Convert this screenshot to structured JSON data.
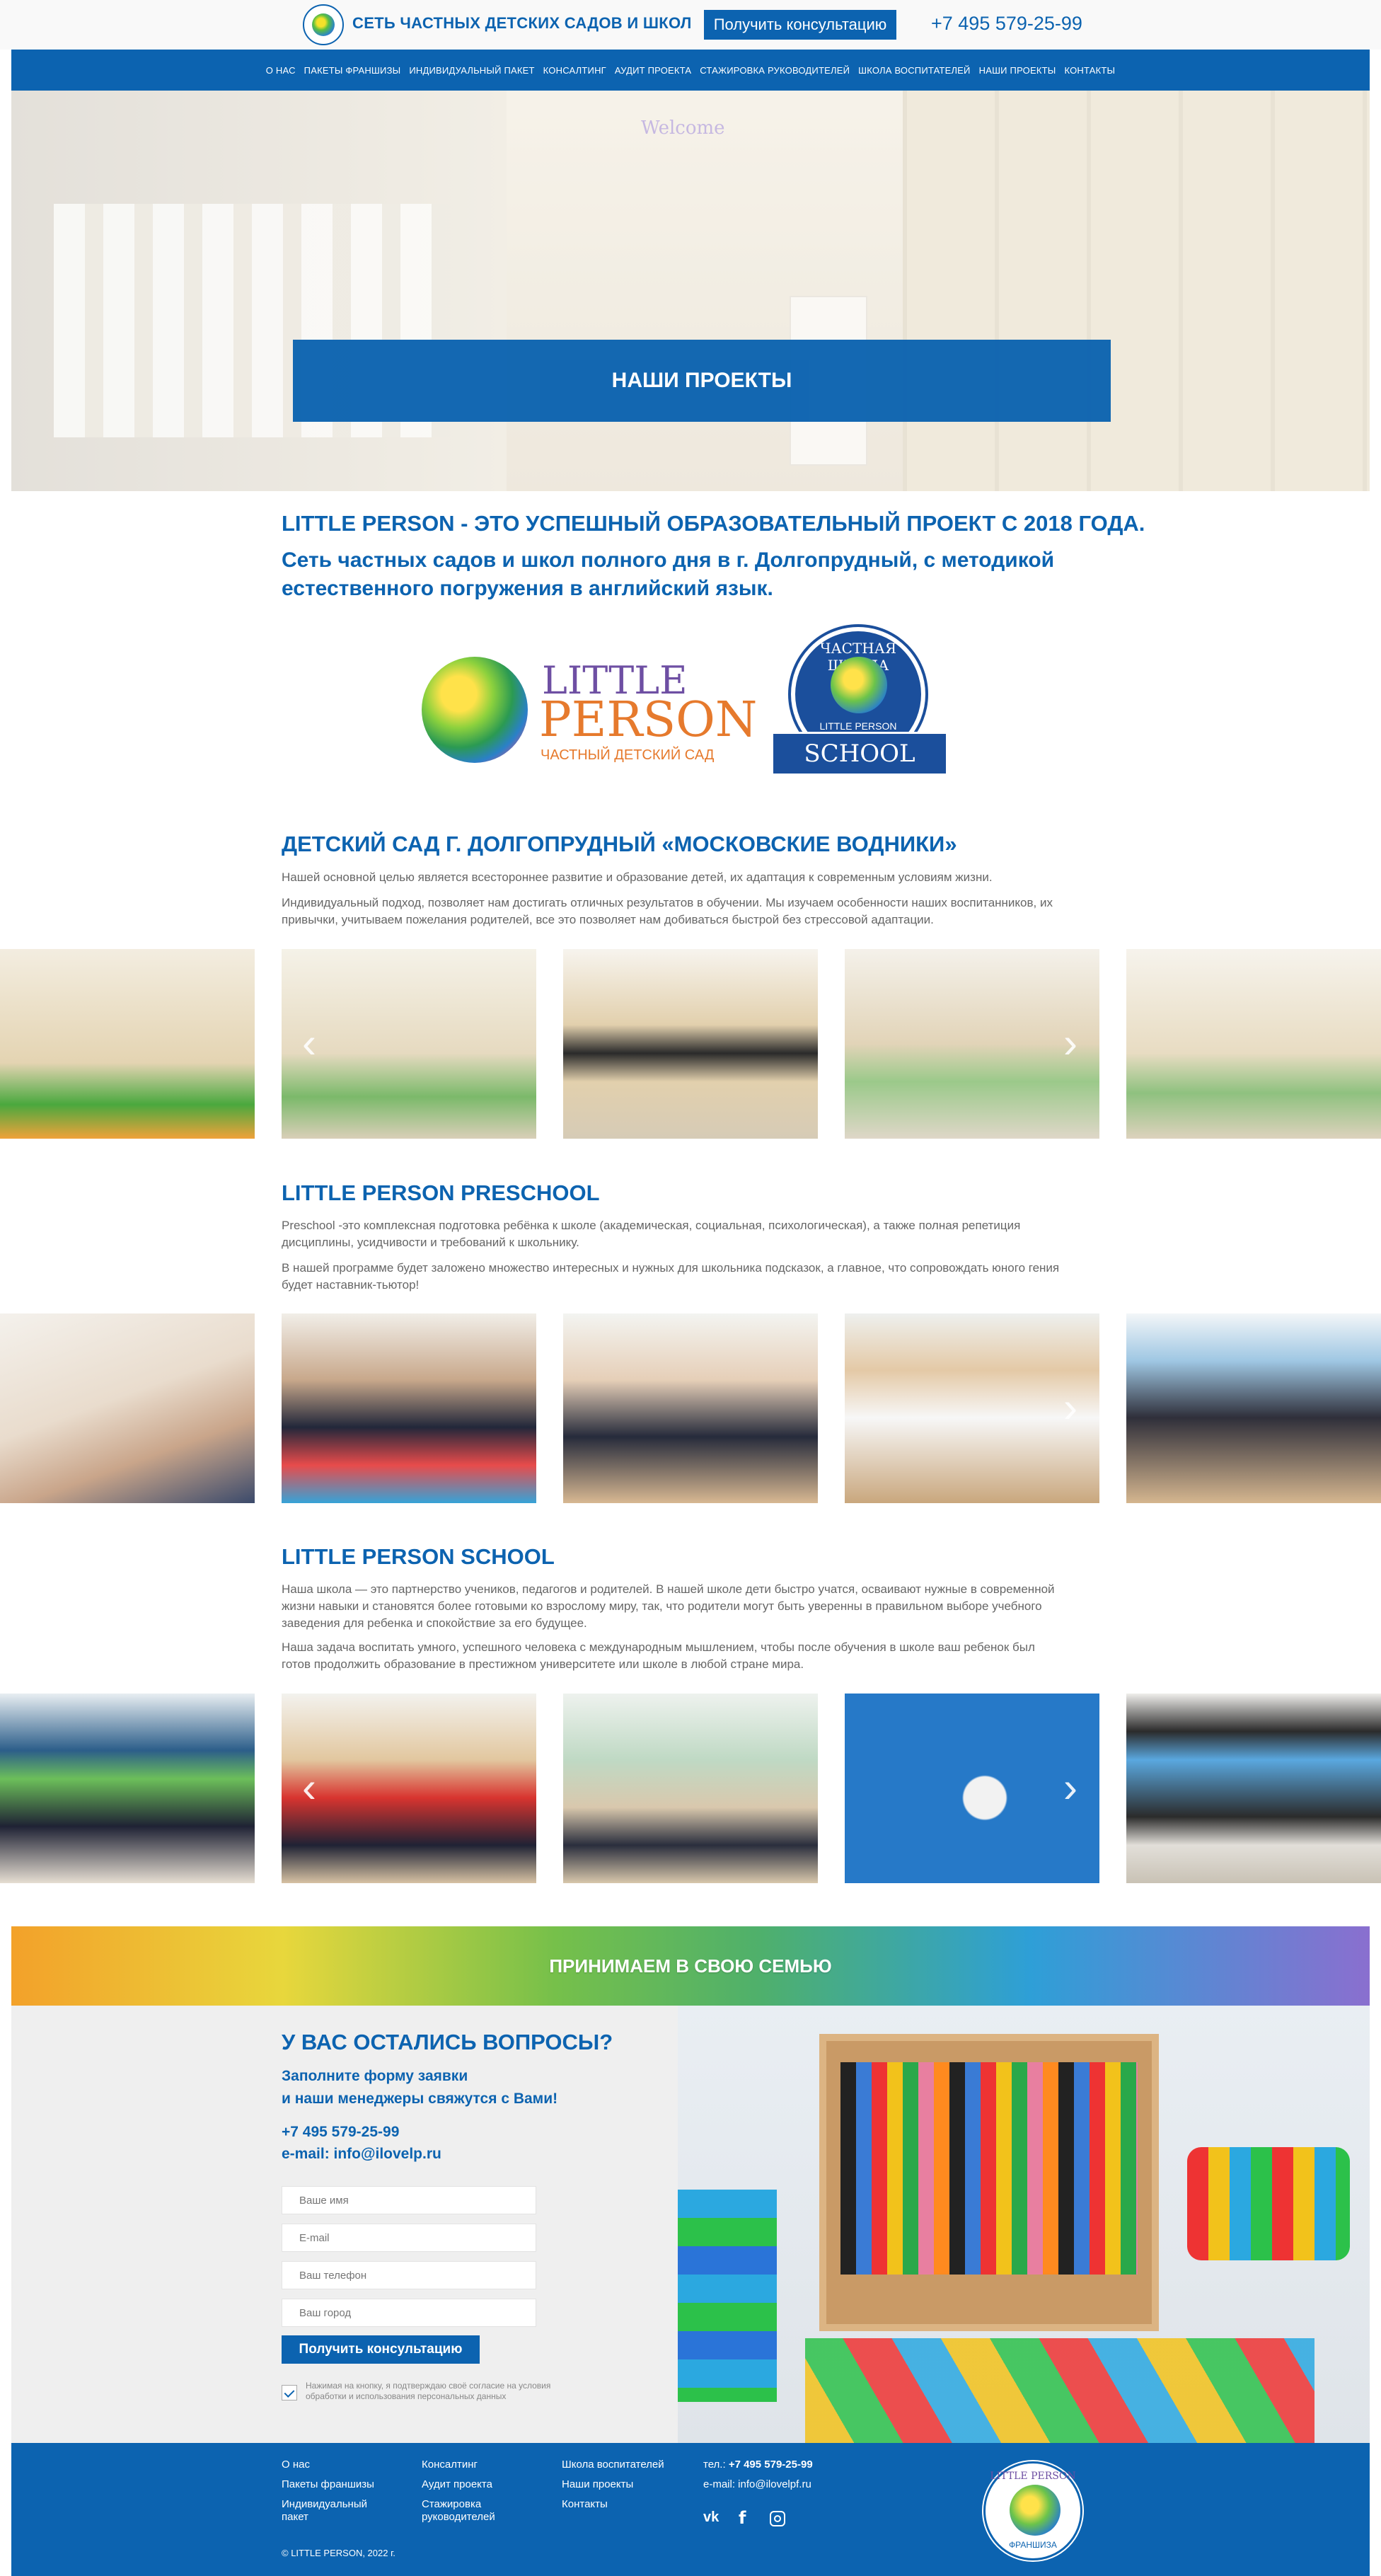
{
  "header": {
    "brand": "СЕТЬ ЧАСТНЫХ ДЕТСКИХ САДОВ И ШКОЛ",
    "cta": "Получить консультацию",
    "phone": "+7 495 579-25-99"
  },
  "nav": [
    "О НАС",
    "ПАКЕТЫ ФРАНШИЗЫ",
    "ИНДИВИДУАЛЬНЫЙ ПАКЕТ",
    "КОНСАЛТИНГ",
    "АУДИТ ПРОЕКТА",
    "СТАЖИРОВКА РУКОВОДИТЕЛЕЙ",
    "ШКОЛА ВОСПИТАТЕЛЕЙ",
    "НАШИ ПРОЕКТЫ",
    "КОНТАКТЫ"
  ],
  "hero": {
    "title": "НАШИ ПРОЕКТЫ",
    "sign": "Welcome"
  },
  "intro": {
    "headline": "LITTLE PERSON - ЭТО УСПЕШНЫЙ ОБРАЗОВАТЕЛЬНЫЙ ПРОЕКТ С 2018 ГОДА.",
    "subhead": "Сеть частных садов и школ полного дня в г. Долгопрудный, с методикой естественного погружения в английский язык."
  },
  "logos": {
    "lp_word1": "LITTLE",
    "lp_word2": "PERSON",
    "lp_caption": "ЧАСТНЫЙ ДЕТСКИЙ САД",
    "school_arc": "ЧАСТНАЯ ШКОЛА",
    "school_mid": "LITTLE PERSON",
    "school_ribbon": "SCHOOL"
  },
  "sections": [
    {
      "title": "ДЕТСКИЙ САД Г. ДОЛГОПРУДНЫЙ «МОСКОВСКИЕ ВОДНИКИ»",
      "p1": "Нашей основной целью является всестороннее развитие и образование детей, их адаптация к современным условиям жизни.",
      "p2": "Индивидуальный подход, позволяет нам достигать отличных результатов в обучении. Мы изучаем особенности наших воспитанников, их привычки, учитываем пожелания родителей, все это позволяет нам добиваться быстрой без стрессовой адаптации."
    },
    {
      "title": "LITTLE PERSON PRESCHOOL",
      "p1": "Preschool -это комплексная подготовка ребёнка к школе (академическая, социальная, психологическая), а также полная репетиция дисциплины, усидчивости и требований к школьнику.",
      "p2": "В нашей программе будет заложено множество интересных и нужных для школьника подсказок, а главное, что сопровождать юного гения будет наставник-тьютор!"
    },
    {
      "title": "LITTLE PERSON SCHOOL",
      "p1": "Наша школа — это партнерство учеников, педагогов и родителей. В нашей школе дети быстро учатся, осваивают нужные в современной жизни навыки и становятся более готовыми ко взрослому миру, так, что родители могут быть уверенны в правильном выборе учебного заведения для ребенка и спокойствие за его будущее.",
      "p2": "Наша задача воспитать умного, успешного человека с международным мышлением, чтобы после обучения в школе ваш ребенок был готов продолжить образование в престижном университете или школе в любой стране мира."
    }
  ],
  "colors": {
    "brand": "#0c63b0",
    "text": "#666666",
    "form_bg": "#efefef"
  },
  "banner": {
    "title": "ПРИНИМАЕМ В СВОЮ СЕМЬЮ"
  },
  "contact_form": {
    "title": "У ВАС ОСТАЛИСЬ ВОПРОСЫ?",
    "subtitle_line1": "Заполните форму заявки",
    "subtitle_line2": "и наши менеджеры свяжутся с Вами!",
    "phone": "+7 495 579-25-99",
    "email": "e-mail: info@ilovelp.ru",
    "name_placeholder": "Ваше имя",
    "email_placeholder": "E-mail",
    "phone_placeholder": "Ваш телефон",
    "city_placeholder": "Ваш город",
    "submit": "Получить консультацию",
    "consent": "Нажимая на кнопку, я подтверждаю своё согласие на условия обработки и использования персональных данных"
  },
  "footer": {
    "col1": [
      "О нас",
      "Пакеты франшизы",
      "Индивидуальный пакет"
    ],
    "col2": [
      "Консалтинг",
      "Аудит проекта",
      "Стажировка руководителей"
    ],
    "col3": [
      "Школа воспитателей",
      "Наши проекты",
      "Контакты"
    ],
    "tel_label": "тел.:",
    "tel": "+7 495 579-25-99",
    "email": "e-mail: info@ilovelpf.ru",
    "social_icons": [
      "vk-icon",
      "facebook-icon",
      "instagram-icon"
    ],
    "copyright": "© LITTLE PERSON, 2022 г.",
    "logo_top": "LITTLE PERSON",
    "logo_bottom": "ФРАНШИЗА"
  }
}
